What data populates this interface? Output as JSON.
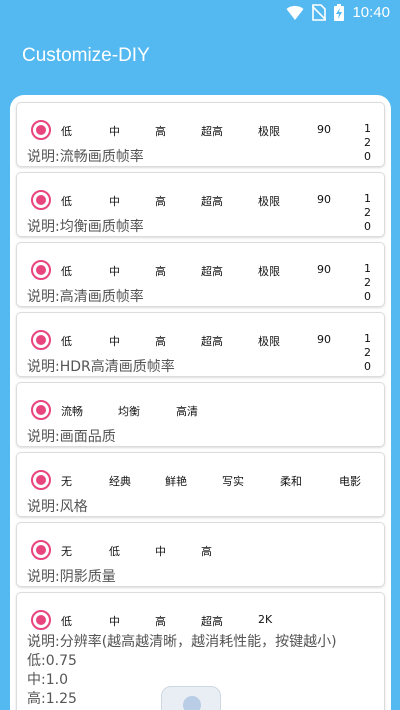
{
  "status": {
    "time": "10:40"
  },
  "app": {
    "title": "Customize-DIY"
  },
  "cards": [
    {
      "options": [
        "低",
        "中",
        "高",
        "超高",
        "极限",
        "90",
        "120"
      ],
      "desc": "说明:流畅画质帧率"
    },
    {
      "options": [
        "低",
        "中",
        "高",
        "超高",
        "极限",
        "90",
        "120"
      ],
      "desc": "说明:均衡画质帧率"
    },
    {
      "options": [
        "低",
        "中",
        "高",
        "超高",
        "极限",
        "90",
        "120"
      ],
      "desc": "说明:高清画质帧率"
    },
    {
      "options": [
        "低",
        "中",
        "高",
        "超高",
        "极限",
        "90",
        "120"
      ],
      "desc": "说明:HDR高清画质帧率"
    },
    {
      "options": [
        "流畅",
        "均衡",
        "高清"
      ],
      "desc": "说明:画面品质"
    },
    {
      "options": [
        "无",
        "经典",
        "鲜艳",
        "写实",
        "柔和",
        "电影"
      ],
      "desc": "说明:风格"
    },
    {
      "options": [
        "无",
        "低",
        "中",
        "高"
      ],
      "desc": "说明:阴影质量"
    },
    {
      "options": [
        "低",
        "中",
        "高",
        "超高",
        "2K"
      ],
      "desc": "说明:分辨率(越高越清晰，越消耗性能，按键越小)\n低:0.75\n中:1.0\n高:1.25"
    }
  ],
  "colors": {
    "background": "#54b9f0",
    "accent": "#e8457f"
  }
}
